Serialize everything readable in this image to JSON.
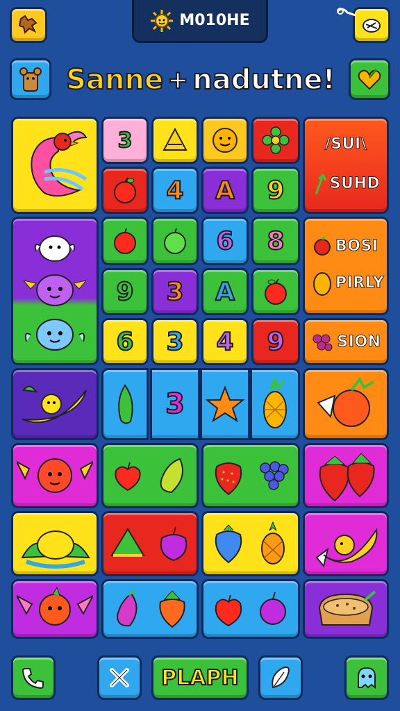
{
  "header": {
    "score_label": "M010HE",
    "title_part1": "Sanne",
    "title_plus": "+",
    "title_part2": "nadutne!"
  },
  "tiles": {
    "r1": [
      "3",
      "",
      "",
      ""
    ],
    "r2": [
      "",
      "4",
      "A",
      "9"
    ],
    "r3": [
      "",
      "",
      "6",
      "8"
    ],
    "r4": [
      "9",
      "3",
      "A",
      ""
    ],
    "r5": [
      "6",
      "3",
      "4",
      "9"
    ],
    "r6_mid": "3"
  },
  "side_panels": {
    "top_line1": "/SUI\\",
    "top_line2": "SUHD",
    "mid_line1": "BOSI",
    "mid_line2": "PIRLY",
    "mid_line3": "SION"
  },
  "footer": {
    "play_label": "PLAPH"
  },
  "colors": {
    "background": "#1f4f9c",
    "yellow": "#ffe21a",
    "green": "#3cc23a",
    "red": "#e8281e",
    "orange": "#ff8a14",
    "purple": "#8a2fd8",
    "magenta": "#e02cd6",
    "blue": "#2fa8f0"
  },
  "icons": [
    "dog-icon",
    "sun-icon",
    "sticker-icon",
    "bear-icon",
    "heart-icon",
    "phone-icon",
    "close-icon",
    "leaf-icon",
    "ghost-icon"
  ]
}
